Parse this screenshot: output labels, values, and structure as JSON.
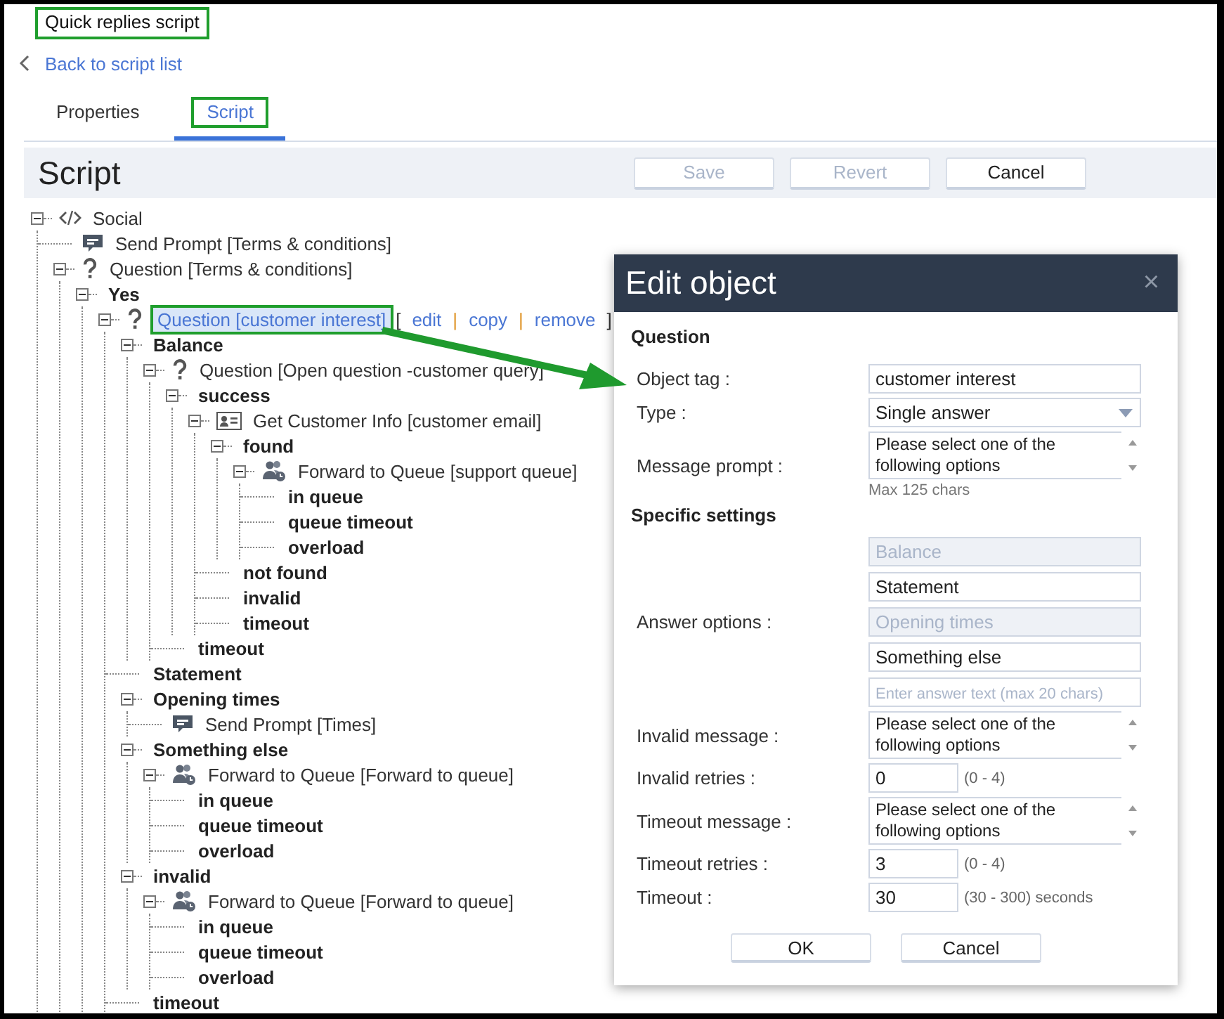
{
  "page_title": {
    "text": "Quick replies script",
    "highlighted": true
  },
  "back_link": "Back to script list",
  "tabs": [
    {
      "label": "Properties",
      "selected": false
    },
    {
      "label": "Script",
      "selected": true,
      "highlighted": true
    }
  ],
  "panel": {
    "title": "Script",
    "buttons": [
      {
        "label": "Save",
        "disabled": true
      },
      {
        "label": "Revert",
        "disabled": true
      },
      {
        "label": "Cancel",
        "disabled": false
      }
    ]
  },
  "tree": [
    {
      "label": "Social",
      "kind": "code",
      "selected": false,
      "expanded": true,
      "children": [
        {
          "label": "Send Prompt [Terms & conditions]",
          "kind": "prompt",
          "selected": false
        },
        {
          "label": "Question [Terms & conditions]",
          "kind": "question",
          "selected": false,
          "expanded": true,
          "children": [
            {
              "label": "Yes",
              "kind": "branch",
              "selected": false,
              "expanded": true,
              "children": [
                {
                  "label": "Question [customer interest]",
                  "kind": "question",
                  "selected": true,
                  "highlighted": true,
                  "actions": [
                    {
                      "kind": "bracket",
                      "text": "["
                    },
                    {
                      "kind": "link",
                      "text": "edit"
                    },
                    {
                      "kind": "separator",
                      "text": "|"
                    },
                    {
                      "kind": "link",
                      "text": "copy"
                    },
                    {
                      "kind": "separator",
                      "text": "|"
                    },
                    {
                      "kind": "link",
                      "text": "remove"
                    },
                    {
                      "kind": "bracket",
                      "text": "]"
                    }
                  ],
                  "expanded": true,
                  "children": [
                    {
                      "label": "Balance",
                      "kind": "branch",
                      "selected": false,
                      "expanded": true,
                      "children": [
                        {
                          "label": "Question [Open question -customer query]",
                          "kind": "question",
                          "selected": false,
                          "expanded": true,
                          "children": [
                            {
                              "label": "success",
                              "kind": "branch",
                              "selected": false,
                              "expanded": true,
                              "children": [
                                {
                                  "label": "Get Customer Info [customer email]",
                                  "kind": "contact",
                                  "selected": false,
                                  "expanded": true,
                                  "children": [
                                    {
                                      "label": "found",
                                      "kind": "branch",
                                      "selected": false,
                                      "expanded": true,
                                      "children": [
                                        {
                                          "label": "Forward to Queue [support queue]",
                                          "kind": "queue",
                                          "selected": false,
                                          "expanded": true,
                                          "children": [
                                            {
                                              "label": "in queue",
                                              "kind": "branch",
                                              "selected": false
                                            },
                                            {
                                              "label": "queue timeout",
                                              "kind": "branch",
                                              "selected": false
                                            },
                                            {
                                              "label": "overload",
                                              "kind": "branch",
                                              "selected": false
                                            }
                                          ]
                                        }
                                      ]
                                    },
                                    {
                                      "label": "not found",
                                      "kind": "branch",
                                      "selected": false
                                    },
                                    {
                                      "label": "invalid",
                                      "kind": "branch",
                                      "selected": false
                                    },
                                    {
                                      "label": "timeout",
                                      "kind": "branch",
                                      "selected": false
                                    }
                                  ]
                                }
                              ]
                            },
                            {
                              "label": "timeout",
                              "kind": "branch",
                              "selected": false
                            }
                          ]
                        }
                      ]
                    },
                    {
                      "label": "Statement",
                      "kind": "branch",
                      "selected": false
                    },
                    {
                      "label": "Opening times",
                      "kind": "branch",
                      "selected": false,
                      "expanded": true,
                      "children": [
                        {
                          "label": "Send Prompt [Times]",
                          "kind": "prompt",
                          "selected": false
                        }
                      ]
                    },
                    {
                      "label": "Something else",
                      "kind": "branch",
                      "selected": false,
                      "expanded": true,
                      "children": [
                        {
                          "label": "Forward to Queue [Forward to queue]",
                          "kind": "queue",
                          "selected": false,
                          "expanded": true,
                          "children": [
                            {
                              "label": "in queue",
                              "kind": "branch",
                              "selected": false
                            },
                            {
                              "label": "queue timeout",
                              "kind": "branch",
                              "selected": false
                            },
                            {
                              "label": "overload",
                              "kind": "branch",
                              "selected": false
                            }
                          ]
                        }
                      ]
                    },
                    {
                      "label": "invalid",
                      "kind": "branch",
                      "selected": false,
                      "expanded": true,
                      "children": [
                        {
                          "label": "Forward to Queue [Forward to queue]",
                          "kind": "queue",
                          "selected": false,
                          "expanded": true,
                          "children": [
                            {
                              "label": "in queue",
                              "kind": "branch",
                              "selected": false
                            },
                            {
                              "label": "queue timeout",
                              "kind": "branch",
                              "selected": false
                            },
                            {
                              "label": "overload",
                              "kind": "branch",
                              "selected": false
                            }
                          ]
                        }
                      ]
                    },
                    {
                      "label": "timeout",
                      "kind": "branch",
                      "selected": false
                    }
                  ]
                }
              ]
            }
          ]
        }
      ]
    }
  ],
  "dialog": {
    "title": "Edit object",
    "close": "×",
    "sections": [
      {
        "heading": "Question",
        "fields": [
          {
            "kind": "text",
            "label": "Object tag :",
            "value": "customer interest"
          },
          {
            "kind": "select",
            "label": "Type :",
            "value": "Single answer"
          },
          {
            "kind": "textarea",
            "label": "Message prompt :",
            "value": "Please select one of the following options",
            "note": "Max 125 chars"
          }
        ]
      },
      {
        "heading": "Specific settings",
        "fields": [
          {
            "kind": "answers",
            "label": "Answer options :",
            "options": [
              {
                "value": "Balance",
                "disabled": true
              },
              {
                "value": "Statement",
                "disabled": false
              },
              {
                "value": "Opening times",
                "disabled": true
              },
              {
                "value": "Something else",
                "disabled": false
              }
            ],
            "placeholder": "Enter answer text (max 20 chars)"
          },
          {
            "kind": "textarea",
            "label": "Invalid message :",
            "value": "Please select one of the following options"
          },
          {
            "kind": "number",
            "label": "Invalid retries :",
            "value": "0",
            "range": "(0 - 4)"
          },
          {
            "kind": "textarea",
            "label": "Timeout message :",
            "value": "Please select one of the following options"
          },
          {
            "kind": "number",
            "label": "Timeout retries :",
            "value": "3",
            "range": "(0 - 4)"
          },
          {
            "kind": "number",
            "label": "Timeout :",
            "value": "30",
            "range": "(30 - 300) seconds"
          }
        ]
      }
    ],
    "buttons": [
      {
        "label": "OK"
      },
      {
        "label": "Cancel"
      }
    ]
  }
}
